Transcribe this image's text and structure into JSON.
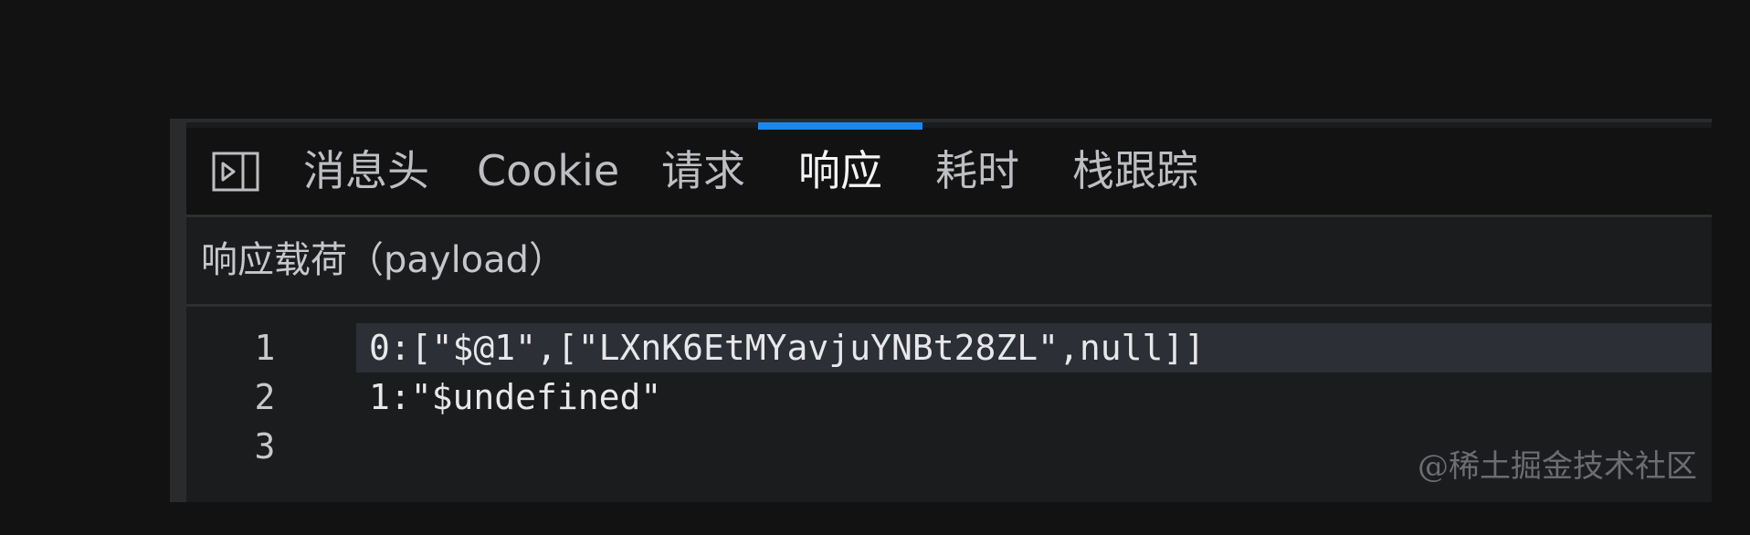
{
  "tabs": [
    {
      "label": "消息头",
      "active": false
    },
    {
      "label": "Cookie",
      "active": false
    },
    {
      "label": "请求",
      "active": false
    },
    {
      "label": "响应",
      "active": true
    },
    {
      "label": "耗时",
      "active": false
    },
    {
      "label": "栈跟踪",
      "active": false
    }
  ],
  "toggle_icon": "panel-toggle-icon",
  "section": {
    "title": "响应载荷（payload）"
  },
  "editor": {
    "lines": [
      {
        "number": "1",
        "text": "0:[\"$@1\",[\"LXnK6EtMYavjuYNBt28ZL\",null]]",
        "highlighted": true
      },
      {
        "number": "2",
        "text": "1:\"$undefined\"",
        "highlighted": false
      },
      {
        "number": "3",
        "text": "",
        "highlighted": false
      }
    ]
  },
  "watermark": "@稀土掘金技术社区",
  "colors": {
    "accent": "#1b88f0",
    "background": "#121213",
    "panel": "#1b1c1e",
    "highlight_line": "#2c2f36"
  }
}
